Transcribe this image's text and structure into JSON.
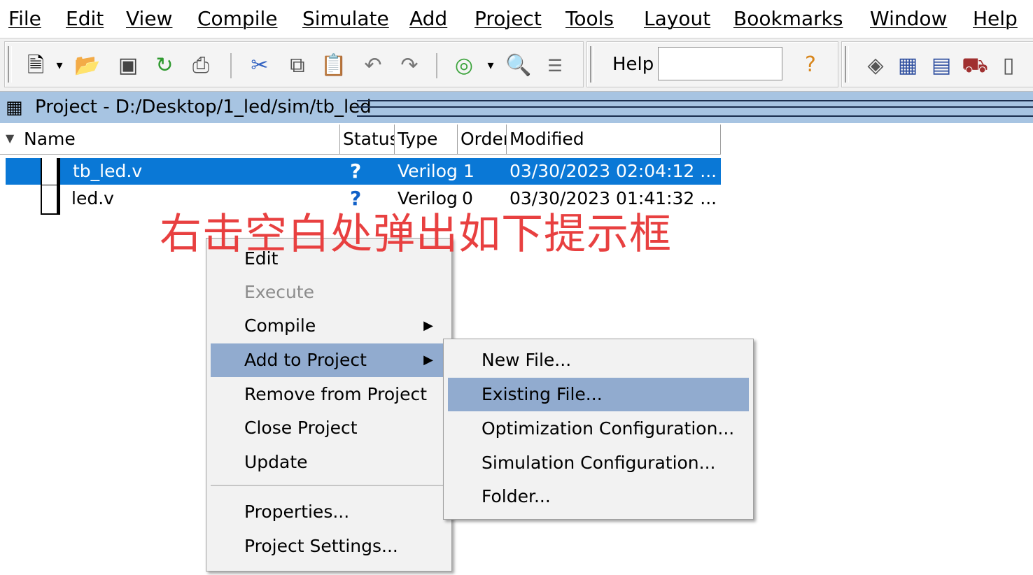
{
  "menubar": {
    "items": [
      "File",
      "Edit",
      "View",
      "Compile",
      "Simulate",
      "Add",
      "Project",
      "Tools",
      "Layout",
      "Bookmarks",
      "Window",
      "Help"
    ]
  },
  "toolbar": {
    "help_label": "Help",
    "help_value": "",
    "icons": [
      "new-document-icon",
      "dropdown-arrow-icon",
      "open-folder-icon",
      "save-icon",
      "refresh-icon",
      "print-icon",
      "cut-icon",
      "copy-icon",
      "paste-icon",
      "undo-icon",
      "redo-icon",
      "compile-icon",
      "find-icon",
      "bookmarks-icon",
      "help-search-icon",
      "layout-icons"
    ]
  },
  "project": {
    "title": "Project - D:/Desktop/1_led/sim/tb_led",
    "columns": [
      "Name",
      "Status",
      "Type",
      "Order",
      "Modified"
    ],
    "files": [
      {
        "name": "tb_led.v",
        "status": "?",
        "type": "Verilog",
        "order": "1",
        "modified": "03/30/2023 02:04:12 ...",
        "selected": true
      },
      {
        "name": "led.v",
        "status": "?",
        "type": "Verilog",
        "order": "0",
        "modified": "03/30/2023 01:41:32 ...",
        "selected": false
      }
    ]
  },
  "annotation": "右击空白处弹出如下提示框",
  "context_menu": {
    "items": [
      "Edit",
      "Execute",
      "Compile",
      "Add to Project",
      "Remove from Project",
      "Close Project",
      "Update",
      "Properties...",
      "Project Settings..."
    ],
    "disabled": [
      "Execute"
    ],
    "highlighted": "Add to Project"
  },
  "submenu": {
    "items": [
      "New File...",
      "Existing File...",
      "Optimization Configuration...",
      "Simulation Configuration...",
      "Folder..."
    ],
    "highlighted": "Existing File..."
  },
  "colors": {
    "selection": "#0a78d6",
    "menu_hover": "#91abcf",
    "title_bar": "#a7c4e2",
    "annotation": "#e84040"
  }
}
